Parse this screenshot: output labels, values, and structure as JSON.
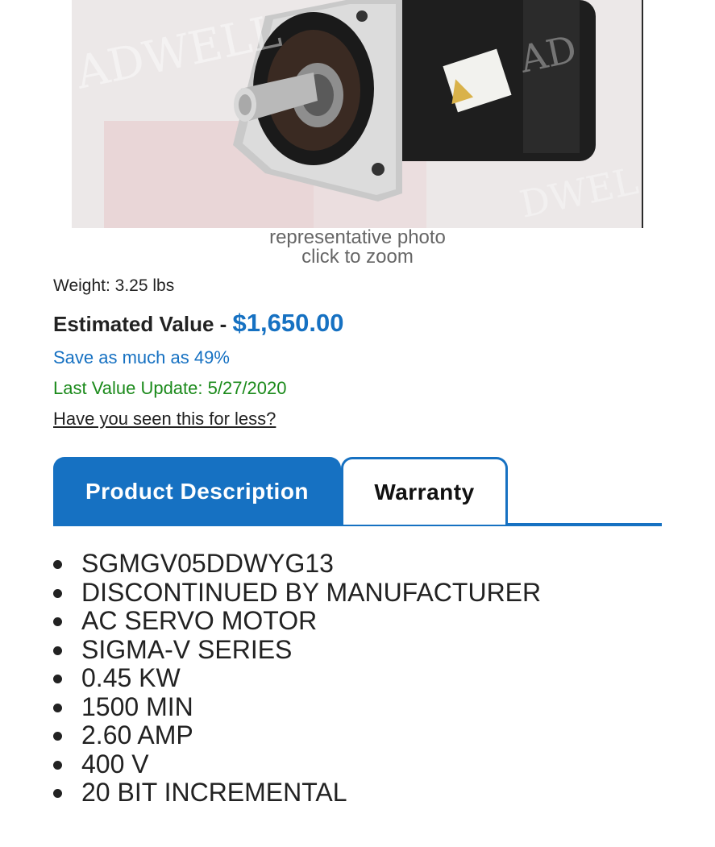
{
  "product_image": {
    "alt": "AC servo motor product photo",
    "caption_line1": "representative photo",
    "caption_line2": "click to zoom"
  },
  "details": {
    "weight": "Weight: 3.25 lbs",
    "estimated_label": "Estimated Value - ",
    "estimated_price": "$1,650.00",
    "save_text": "Save as much as 49%",
    "last_update": "Last Value Update: 5/27/2020",
    "seen_less_link": "Have you seen this for less?"
  },
  "tabs": [
    {
      "label": "Product Description",
      "active": true
    },
    {
      "label": "Warranty",
      "active": false
    }
  ],
  "specs": [
    "SGMGV05DDWYG13",
    "DISCONTINUED BY MANUFACTURER",
    "AC SERVO MOTOR",
    "SIGMA-V SERIES",
    "0.45 KW",
    "1500 MIN",
    "2.60 AMP",
    "400 V",
    "20 BIT INCREMENTAL"
  ],
  "colors": {
    "accent_blue": "#1671c2",
    "update_green": "#1b8a1b"
  }
}
